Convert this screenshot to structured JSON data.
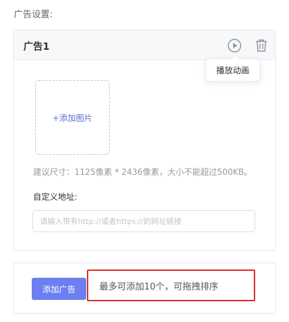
{
  "section_label": "广告设置:",
  "ad_card": {
    "title": "广告1",
    "icons": {
      "play": "play-circle-icon",
      "delete": "trash-icon"
    },
    "tooltip": "播放动画",
    "upload_label": "+添加图片",
    "size_hint": "建议尺寸：1125像素 * 2436像素，大小不能超过500KB。",
    "url_label": "自定义地址:",
    "url_placeholder": "请输入带有http://或者https://的网址链接",
    "url_value": ""
  },
  "bottom": {
    "add_button_label": "添加广告",
    "hint_text": "最多可添加10个，可拖拽排序"
  },
  "colors": {
    "accent": "#6b7ff0",
    "upload_text": "#5b6ed1",
    "highlight_border": "#d8302c"
  }
}
